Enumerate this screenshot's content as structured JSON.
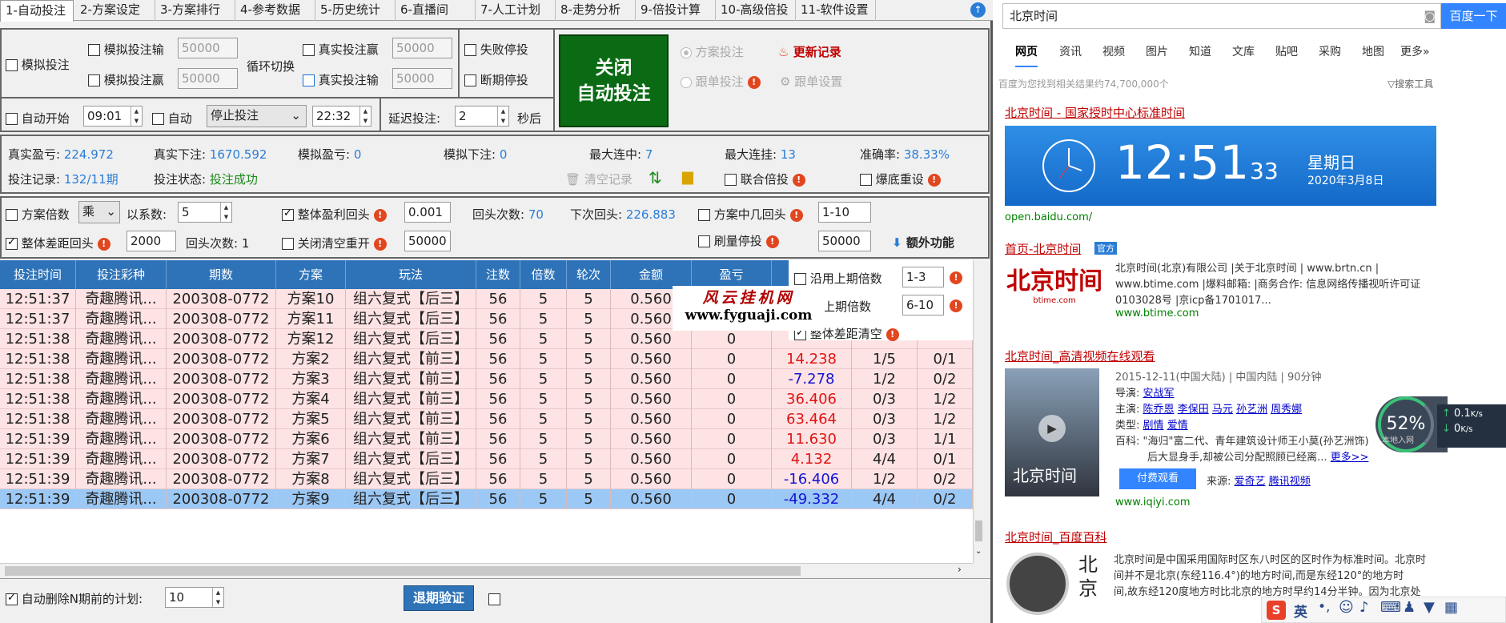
{
  "tabs": [
    "1-自动投注",
    "2-方案设定",
    "3-方案排行",
    "4-参考数据",
    "5-历史统计",
    "6-直播间",
    "7-人工计划",
    "8-走势分析",
    "9-倍投计算",
    "10-高级倍投",
    "11-软件设置"
  ],
  "sim": {
    "label": "模拟投注",
    "loss_label": "模拟投注输",
    "loss_val": "50000",
    "win_label": "模拟投注赢",
    "win_val": "50000",
    "cycle": "循环切换",
    "real_win_label": "真实投注赢",
    "real_win_val": "50000",
    "real_loss_label": "真实投注输",
    "real_loss_val": "50000",
    "fail_stop": "失败停投",
    "break_stop": "断期停投"
  },
  "big_button": {
    "line1": "关闭",
    "line2": "自动投注"
  },
  "mode": {
    "plan": "方案投注",
    "follow": "跟单投注",
    "update": "更新记录",
    "follow_set": "跟单设置"
  },
  "timer": {
    "auto_start": "自动开始",
    "start_time": "09:01",
    "auto": "自动",
    "action": "停止投注",
    "end_time": "22:32",
    "delay_label": "延迟投注:",
    "delay_val": "2",
    "sec": "秒后"
  },
  "stats": {
    "real_profit_l": "真实盈亏:",
    "real_profit": "224.972",
    "real_bet_l": "真实下注:",
    "real_bet": "1670.592",
    "sim_profit_l": "模拟盈亏:",
    "sim_profit": "0",
    "sim_bet_l": "模拟下注:",
    "sim_bet": "0",
    "max_win_l": "最大连中:",
    "max_win": "7",
    "max_lose_l": "最大连挂:",
    "max_lose": "13",
    "acc_l": "准确率:",
    "acc": "38.33%",
    "record_l": "投注记录:",
    "record": "132/11期",
    "status_l": "投注状态:",
    "status": "投注成功",
    "clear": "清空记录",
    "joint": "联合倍投",
    "burst": "爆底重设"
  },
  "opts": {
    "multi": "方案倍数",
    "op": "乘",
    "coef_l": "以系数:",
    "coef": "5",
    "total_profit": "整体盈利回头",
    "tp_val": "0.001",
    "back_count_l": "回头次数:",
    "back_count": "70",
    "next_back_l": "下次回头:",
    "next_back": "226.883",
    "plan_back": "方案中几回头",
    "pb_val": "1-10",
    "total_diff": "整体差距回头",
    "td_val": "2000",
    "td_count_l": "回头次数:",
    "td_count": "1",
    "close_clear": "关闭清空重开",
    "cc_val": "50000",
    "brush": "刷量停投",
    "brush_val": "50000",
    "extra": "额外功能"
  },
  "float": {
    "use_prev": "沿用上期倍数",
    "use_prev_val": "1-3",
    "up_prev": "上上期倍数",
    "up_prev_val": "6-10",
    "diff_clear": "整体差距清空"
  },
  "watermark": {
    "l1": "风云挂机网",
    "l2": "www.fyguaji.com"
  },
  "columns": [
    "投注时间",
    "投注彩种",
    "期数",
    "方案",
    "玩法",
    "注数",
    "倍数",
    "轮次",
    "金额",
    "盈亏"
  ],
  "rows": [
    [
      "12:51:37",
      "奇趣腾讯...",
      "200308-0772",
      "方案10",
      "组六复式【后三】",
      "56",
      "5",
      "5",
      "0.560",
      "",
      "",
      "",
      ""
    ],
    [
      "12:51:37",
      "奇趣腾讯...",
      "200308-0772",
      "方案11",
      "组六复式【后三】",
      "56",
      "5",
      "5",
      "0.560",
      "",
      "",
      "",
      ""
    ],
    [
      "12:51:38",
      "奇趣腾讯...",
      "200308-0772",
      "方案12",
      "组六复式【后三】",
      "56",
      "5",
      "5",
      "0.560",
      "0",
      "",
      "",
      ""
    ],
    [
      "12:51:38",
      "奇趣腾讯...",
      "200308-0772",
      "方案2",
      "组六复式【前三】",
      "56",
      "5",
      "5",
      "0.560",
      "0",
      "14.238",
      "1/5",
      "0/1"
    ],
    [
      "12:51:38",
      "奇趣腾讯...",
      "200308-0772",
      "方案3",
      "组六复式【前三】",
      "56",
      "5",
      "5",
      "0.560",
      "0",
      "-7.278",
      "1/2",
      "0/2"
    ],
    [
      "12:51:38",
      "奇趣腾讯...",
      "200308-0772",
      "方案4",
      "组六复式【前三】",
      "56",
      "5",
      "5",
      "0.560",
      "0",
      "36.406",
      "0/3",
      "1/2"
    ],
    [
      "12:51:38",
      "奇趣腾讯...",
      "200308-0772",
      "方案5",
      "组六复式【前三】",
      "56",
      "5",
      "5",
      "0.560",
      "0",
      "63.464",
      "0/3",
      "1/2"
    ],
    [
      "12:51:39",
      "奇趣腾讯...",
      "200308-0772",
      "方案6",
      "组六复式【前三】",
      "56",
      "5",
      "5",
      "0.560",
      "0",
      "11.630",
      "0/3",
      "1/1"
    ],
    [
      "12:51:39",
      "奇趣腾讯...",
      "200308-0772",
      "方案7",
      "组六复式【后三】",
      "56",
      "5",
      "5",
      "0.560",
      "0",
      "4.132",
      "4/4",
      "0/1"
    ],
    [
      "12:51:39",
      "奇趣腾讯...",
      "200308-0772",
      "方案8",
      "组六复式【后三】",
      "56",
      "5",
      "5",
      "0.560",
      "0",
      "-16.406",
      "1/2",
      "0/2"
    ],
    [
      "12:51:39",
      "奇趣腾讯...",
      "200308-0772",
      "方案9",
      "组六复式【后三】",
      "56",
      "5",
      "5",
      "0.560",
      "0",
      "-49.332",
      "4/4",
      "0/2"
    ]
  ],
  "bottom": {
    "auto_del": "自动删除N期前的计划:",
    "auto_del_val": "10",
    "verify": "退期验证"
  },
  "browser": {
    "query": "北京时间",
    "search_btn": "百度一下",
    "nav": [
      "网页",
      "资讯",
      "视频",
      "图片",
      "知道",
      "文库",
      "贴吧",
      "采购",
      "地图",
      "更多»"
    ],
    "result_count": "百度为您找到相关结果约74,700,000个",
    "tools": "搜索工具",
    "r1_title": "北京时间 - 国家授时中心标准时间",
    "clock_hm": "12:51",
    "clock_s": "33",
    "weekday": "星期日",
    "date": "2020年3月8日",
    "r1_url": "open.baidu.com/",
    "r2_title": "首页-北京时间",
    "r2_badge": "官方",
    "r2_logo": "北京时间",
    "r2_logo_sub": "btime.com",
    "r2_l1": "北京时间(北京)有限公司 |关于北京时间 | www.brtn.cn |",
    "r2_l2": "www.btime.com |爆料邮箱: |商务合作: 信息网络传播视听许可证",
    "r2_l3": "0103028号 |京icp备1701017...",
    "r2_url": "www.btime.com",
    "r3_title": "北京时间_高清视频在线观看",
    "r3_meta": "2015-12-11(中国大陆) | 中国内陆 | 90分钟",
    "r3_dir_l": "导演:",
    "r3_dir": "安战军",
    "r3_cast_l": "主演:",
    "r3_cast": [
      "陈乔恩",
      "李保田",
      "马元",
      "孙艺洲",
      "周秀娜"
    ],
    "r3_type_l": "类型:",
    "r3_type": [
      "剧情",
      "爱情"
    ],
    "r3_desc_l": "百科:",
    "r3_desc": "\"海归\"富二代、青年建筑设计师王小莫(孙艺洲饰)",
    "r3_desc2": "后大显身手,却被公司分配照顾已经离...",
    "r3_more": "更多>>",
    "r3_watch": "付费观看",
    "r3_src_l": "来源:",
    "r3_src": [
      "爱奇艺",
      "腾讯视频"
    ],
    "r3_url": "www.iqiyi.com",
    "poster": "北京时间",
    "r4_title": "北京时间_百度百科",
    "r4_l1": "北京时间是中国采用国际时区东八时区的区时作为标准时间。北京时",
    "r4_l2": "间并不是北京(东经116.4°)的地方时间,而是东经120°的地方时",
    "r4_l3": "间,故东经120度地方时比北京的地方时早约14分半钟。因为北京处",
    "r4_thumb": "北京"
  },
  "widget": {
    "pct": "52%",
    "up": "0.1",
    "up_unit": "K/s",
    "down": "0",
    "down_unit": "K/s",
    "note": "本地入网"
  },
  "ime": {
    "lang": "英"
  }
}
